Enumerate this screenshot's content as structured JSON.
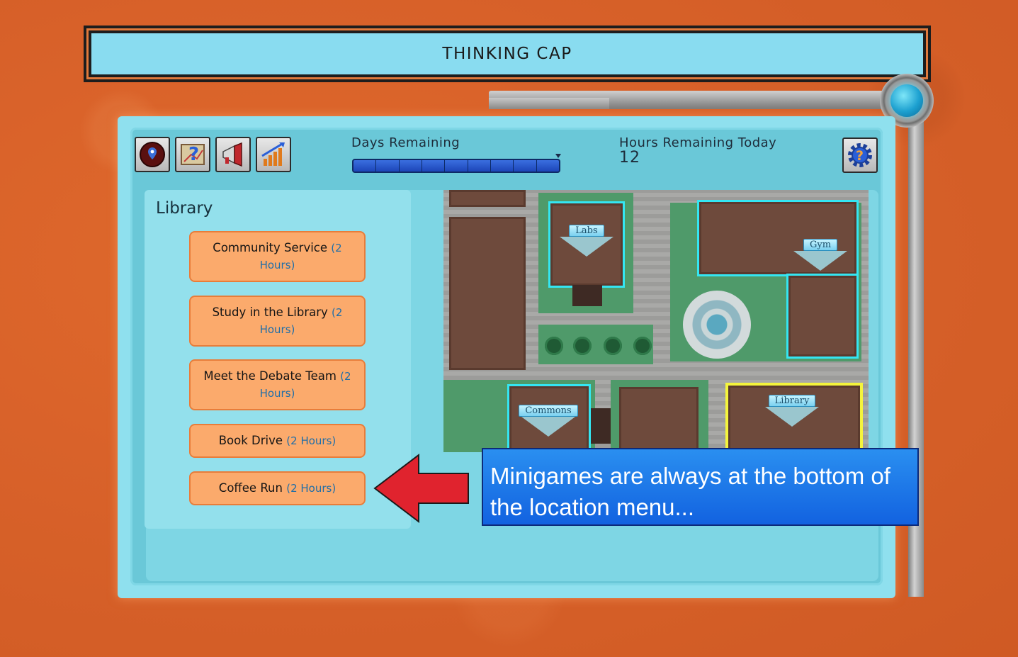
{
  "header": {
    "title": "THINKING CAP"
  },
  "toolbar": {
    "icons": [
      "map-pin-icon",
      "quest-map-icon",
      "megaphone-icon",
      "stats-chart-icon"
    ]
  },
  "status": {
    "days_label": "Days Remaining",
    "days_segments": 9,
    "hours_label": "Hours Remaining Today",
    "hours_value": "12"
  },
  "location_menu": {
    "title": "Library",
    "activities": [
      {
        "name": "Community Service",
        "hours": "(2 Hours)"
      },
      {
        "name": "Study in the Library",
        "hours": "(2 Hours)"
      },
      {
        "name": "Meet the Debate Team",
        "hours": "(2 Hours)"
      },
      {
        "name": "Book Drive",
        "hours": "(2 Hours)"
      },
      {
        "name": "Coffee Run",
        "hours": "(2 Hours)"
      }
    ]
  },
  "map": {
    "locations": [
      "Labs",
      "Gym",
      "Commons",
      "Library"
    ],
    "selected": "Library"
  },
  "tutorial": {
    "text": "Minigames are always at the bottom of the location menu..."
  },
  "colors": {
    "background": "#d9622a",
    "panel": "#8fe0ee",
    "button": "#fbaa6c",
    "highlight": "#34e6f2",
    "selected": "#f4f43c",
    "callout": "#1a72e8"
  }
}
